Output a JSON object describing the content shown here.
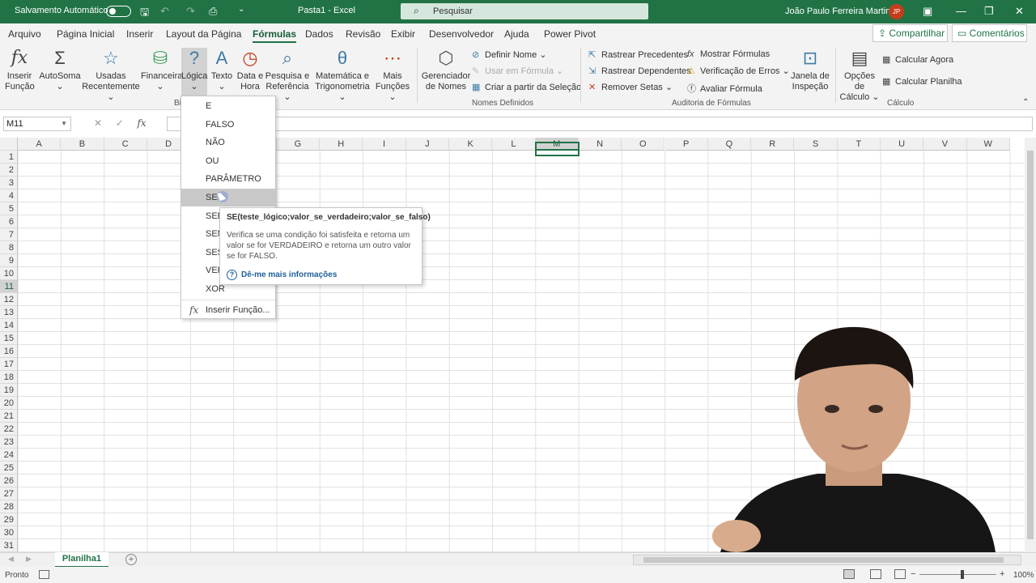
{
  "titlebar": {
    "autosave_label": "Salvamento Automático",
    "doc_title": "Pasta1  -  Excel",
    "search_placeholder": "Pesquisar",
    "user_name": "João Paulo Ferreira Martins",
    "user_initials": "JP",
    "accent": "#217346"
  },
  "tabs": [
    "Arquivo",
    "Página Inicial",
    "Inserir",
    "Layout da Página",
    "Fórmulas",
    "Dados",
    "Revisão",
    "Exibir",
    "Desenvolvedor",
    "Ajuda",
    "Power Pivot"
  ],
  "active_tab": "Fórmulas",
  "share_label": "Compartilhar",
  "comments_label": "Comentários",
  "ribbon": {
    "insert_function": [
      "Inserir",
      "Função"
    ],
    "autosum": [
      "AutoSoma"
    ],
    "recent": [
      "Usadas",
      "Recentemente"
    ],
    "financial": [
      "Financeira"
    ],
    "logical": [
      "Lógica"
    ],
    "text": [
      "Texto"
    ],
    "datetime": [
      "Data e",
      "Hora"
    ],
    "lookup": [
      "Pesquisa e",
      "Referência"
    ],
    "math": [
      "Matemática e",
      "Trigonometria"
    ],
    "more": [
      "Mais",
      "Funções"
    ],
    "name_manager": [
      "Gerenciador",
      "de Nomes"
    ],
    "define_name": "Definir Nome",
    "use_in_formula": "Usar em Fórmula",
    "create_from_selection": "Criar a partir da Seleção",
    "group_names": "Nomes Definidos",
    "trace_precedents": "Rastrear Precedentes",
    "trace_dependents": "Rastrear Dependentes",
    "remove_arrows": "Remover Setas",
    "show_formulas": "Mostrar Fórmulas",
    "error_checking": "Verificação de Erros",
    "evaluate_formula": "Avaliar Fórmula",
    "watch_window": [
      "Janela de",
      "Inspeção"
    ],
    "group_audit": "Auditoria de Fórmulas",
    "calc_options": [
      "Opções de",
      "Cálculo"
    ],
    "calc_now": "Calcular Agora",
    "calc_sheet": "Calcular Planilha",
    "group_calc": "Cálculo",
    "group_lib_partial": "Bi"
  },
  "namebox": "M11",
  "columns": [
    "A",
    "B",
    "C",
    "D",
    "E",
    "F",
    "G",
    "H",
    "I",
    "J",
    "K",
    "L",
    "M",
    "N",
    "O",
    "P",
    "Q",
    "R",
    "S",
    "T",
    "U",
    "V",
    "W"
  ],
  "rows": [
    "1",
    "2",
    "3",
    "4",
    "5",
    "6",
    "7",
    "8",
    "9",
    "10",
    "11",
    "12",
    "13",
    "14",
    "15",
    "16",
    "17",
    "18",
    "19",
    "20",
    "21",
    "22",
    "23",
    "24",
    "25",
    "26",
    "27",
    "28",
    "29",
    "30",
    "31"
  ],
  "selected_col": "M",
  "selected_row": "11",
  "dropdown": {
    "items": [
      "E",
      "FALSO",
      "NÃO",
      "OU",
      "PARÂMETRO",
      "SE",
      "SEE",
      "SEN",
      "SES",
      "VER",
      "XOR"
    ],
    "hovered": "SE",
    "insert_function": "Inserir Função..."
  },
  "tooltip": {
    "title": "SE(teste_lógico;valor_se_verdadeiro;valor_se_falso)",
    "description": "Verifica se uma condição foi satisfeita e retorna um valor se for VERDADEIRO e retorna um outro valor se for FALSO.",
    "help": "Dê-me mais informações"
  },
  "sheet_tab": "Planilha1",
  "status": {
    "ready": "Pronto",
    "zoom": "100%"
  }
}
